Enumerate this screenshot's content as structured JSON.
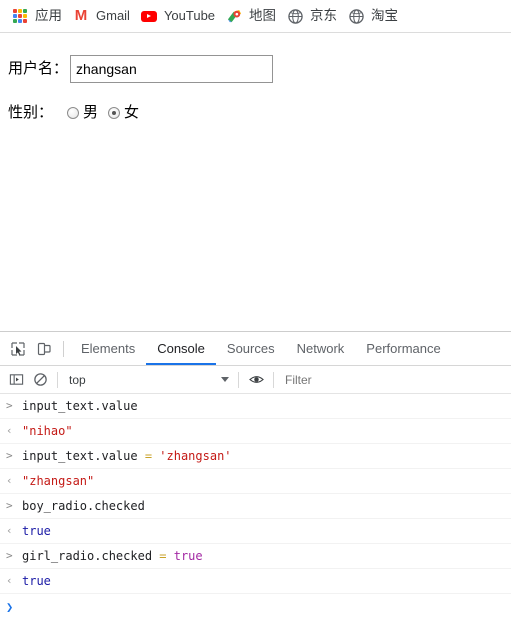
{
  "bookmarks_bar": {
    "items": [
      {
        "label": "应用",
        "icon": "apps-grid-icon"
      },
      {
        "label": "Gmail",
        "icon": "gmail-icon"
      },
      {
        "label": "YouTube",
        "icon": "youtube-icon"
      },
      {
        "label": "地图",
        "icon": "google-maps-icon"
      },
      {
        "label": "京东",
        "icon": "globe-icon"
      },
      {
        "label": "淘宝",
        "icon": "globe-icon"
      }
    ]
  },
  "page": {
    "username": {
      "label": "用户名：",
      "value": "zhangsan",
      "placeholder": ""
    },
    "gender": {
      "label": "性别：",
      "options": [
        {
          "label": "男",
          "checked": false
        },
        {
          "label": "女",
          "checked": true
        }
      ]
    }
  },
  "devtools": {
    "icons": {
      "inspect": "inspect-element-icon",
      "device": "device-toolbar-icon"
    },
    "tabs": [
      {
        "label": "Elements",
        "active": false
      },
      {
        "label": "Console",
        "active": true
      },
      {
        "label": "Sources",
        "active": false
      },
      {
        "label": "Network",
        "active": false
      },
      {
        "label": "Performance",
        "active": false
      }
    ],
    "console_toolbar": {
      "sidebar_icon": "console-sidebar-icon",
      "clear_icon": "clear-console-icon",
      "context": "top",
      "eye_icon": "live-expression-eye-icon",
      "filter_placeholder": "Filter"
    },
    "console_rows": [
      {
        "kind": "input",
        "gutter": ">",
        "tokens": [
          {
            "text": "input_text.value",
            "type": "plain"
          }
        ]
      },
      {
        "kind": "output",
        "gutter": "‹",
        "tokens": [
          {
            "text": "\"nihao\"",
            "type": "string"
          }
        ]
      },
      {
        "kind": "input",
        "gutter": ">",
        "tokens": [
          {
            "text": "input_text.value ",
            "type": "plain"
          },
          {
            "text": "= ",
            "type": "op"
          },
          {
            "text": "'zhangsan'",
            "type": "string"
          }
        ]
      },
      {
        "kind": "output",
        "gutter": "‹",
        "tokens": [
          {
            "text": "\"zhangsan\"",
            "type": "string"
          }
        ]
      },
      {
        "kind": "input",
        "gutter": ">",
        "tokens": [
          {
            "text": "boy_radio.checked",
            "type": "plain"
          }
        ]
      },
      {
        "kind": "output",
        "gutter": "‹",
        "tokens": [
          {
            "text": "true",
            "type": "bool"
          }
        ]
      },
      {
        "kind": "input",
        "gutter": ">",
        "tokens": [
          {
            "text": "girl_radio.checked ",
            "type": "plain"
          },
          {
            "text": "= ",
            "type": "op"
          },
          {
            "text": "true",
            "type": "kw"
          }
        ]
      },
      {
        "kind": "output",
        "gutter": "‹",
        "tokens": [
          {
            "text": "true",
            "type": "bool"
          }
        ]
      },
      {
        "kind": "prompt",
        "gutter": "❯",
        "tokens": []
      }
    ]
  },
  "colors": {
    "accent": "#1a73e8",
    "string": "#c41a16",
    "boolean": "#1a1aa6",
    "keyword": "#a329a3",
    "operator": "#c9a227"
  }
}
